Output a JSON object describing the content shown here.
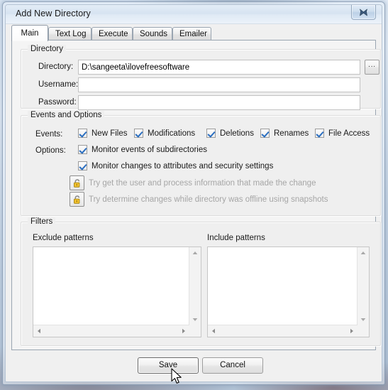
{
  "window": {
    "title": "Add New Directory",
    "close_icon": "close-x-icon"
  },
  "tabs": [
    {
      "label": "Main",
      "active": true
    },
    {
      "label": "Text Log",
      "active": false
    },
    {
      "label": "Execute",
      "active": false
    },
    {
      "label": "Sounds",
      "active": false
    },
    {
      "label": "Emailer",
      "active": false
    }
  ],
  "directory_group": {
    "title": "Directory",
    "fields": [
      {
        "label": "Directory:",
        "value": "D:\\sangeeta\\ilovefreesoftware",
        "placeholder": ""
      },
      {
        "label": "Username:",
        "value": "",
        "placeholder": ""
      },
      {
        "label": "Password:",
        "value": "",
        "placeholder": ""
      }
    ],
    "browse_label": "..."
  },
  "events_group": {
    "title": "Events and Options",
    "events_label": "Events:",
    "options_label": "Options:",
    "events": [
      {
        "label": "New Files",
        "checked": true
      },
      {
        "label": "Modifications",
        "checked": true
      },
      {
        "label": "Deletions",
        "checked": true
      },
      {
        "label": "Renames",
        "checked": true
      },
      {
        "label": "File Access",
        "checked": true
      }
    ],
    "options": [
      {
        "label": "Monitor events of subdirectories",
        "checked": true
      },
      {
        "label": "Monitor changes to attributes and security settings",
        "checked": true
      }
    ],
    "locked_options": [
      {
        "label": "Try get the user and process information that made the change",
        "icon": "padlock-open-icon"
      },
      {
        "label": "Try determine changes while directory was offline using snapshots",
        "icon": "padlock-open-icon"
      }
    ]
  },
  "filters_group": {
    "title": "Filters",
    "exclude_caption": "Exclude patterns",
    "include_caption": "Include patterns",
    "exclude_items": [],
    "include_items": []
  },
  "footer": {
    "save_label": "Save",
    "cancel_label": "Cancel"
  },
  "colors": {
    "dialog_background": "#f0f0f0",
    "group_background": "#efefef",
    "checkmark": "#2a6ec0",
    "lock_yellow": "#f2c12e",
    "disabled_text": "#a6a6a6"
  }
}
